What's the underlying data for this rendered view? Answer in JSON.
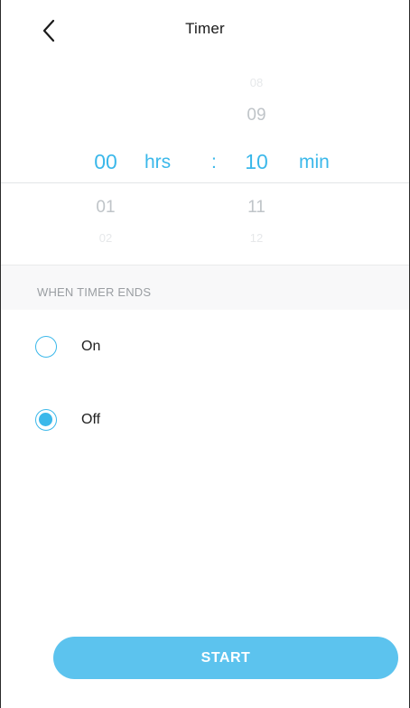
{
  "header": {
    "title": "Timer",
    "back_icon": "chevron-left-icon"
  },
  "picker": {
    "hours": {
      "above_far": "",
      "above_near": "",
      "selected": "00",
      "below_near": "01",
      "below_far": "02",
      "unit": "hrs"
    },
    "separator": ":",
    "minutes": {
      "above_far": "08",
      "above_near": "09",
      "selected": "10",
      "below_near": "11",
      "below_far": "12",
      "unit": "min"
    }
  },
  "section": {
    "label": "WHEN TIMER ENDS"
  },
  "options": [
    {
      "label": "On",
      "selected": false
    },
    {
      "label": "Off",
      "selected": true
    }
  ],
  "start_button": {
    "label": "START"
  },
  "colors": {
    "accent": "#3bb8ea",
    "button": "#5cc3ee",
    "muted_text": "#9a9ea2"
  }
}
